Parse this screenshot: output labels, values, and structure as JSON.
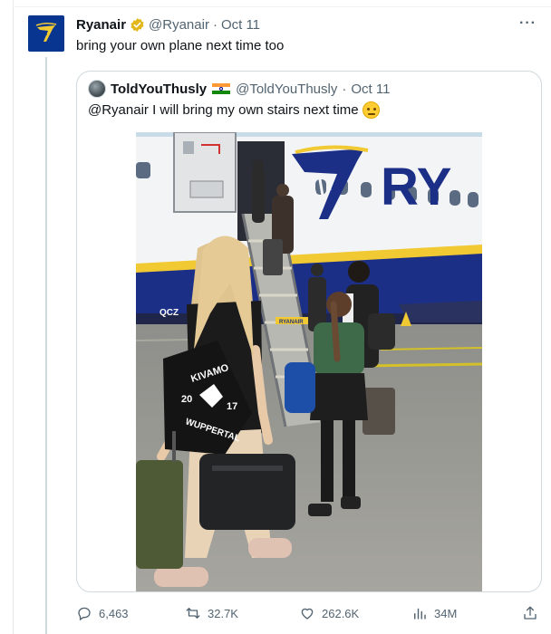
{
  "tweet": {
    "author_name": "Ryanair",
    "author_handle": "@Ryanair",
    "separator": "·",
    "date": "Oct 11",
    "text": "bring your own plane next time too",
    "more_label": "···"
  },
  "quote": {
    "author_name": "ToldYouThusly",
    "author_handle": "@ToldYouThusly",
    "separator": "·",
    "date": "Oct 11",
    "text": "@Ryanair I will bring my own stairs next time",
    "photo": {
      "airline_livery": "RY",
      "registration": "QCZ",
      "bag_text": {
        "brand": "KIVAMO",
        "year_left": "20",
        "year_right": "17",
        "city": "WUPPERTAL"
      },
      "stairs_label": "RYANAIR"
    }
  },
  "actions": {
    "replies": "6,463",
    "reposts": "32.7K",
    "likes": "262.6K",
    "views": "34M"
  },
  "colors": {
    "ryanair_blue": "#073590",
    "ryanair_yellow": "#f1c933",
    "muted_text": "#536471",
    "border": "#cfd9de",
    "verified_gold": "#e2b719"
  },
  "icons": {
    "verified": "verified-gold-badge-icon",
    "more": "more-horizontal-icon",
    "reply": "reply-bubble-icon",
    "repost": "repost-arrows-icon",
    "like": "heart-icon",
    "views": "bar-chart-icon",
    "share": "share-upload-icon",
    "flag": "india-flag-icon"
  }
}
